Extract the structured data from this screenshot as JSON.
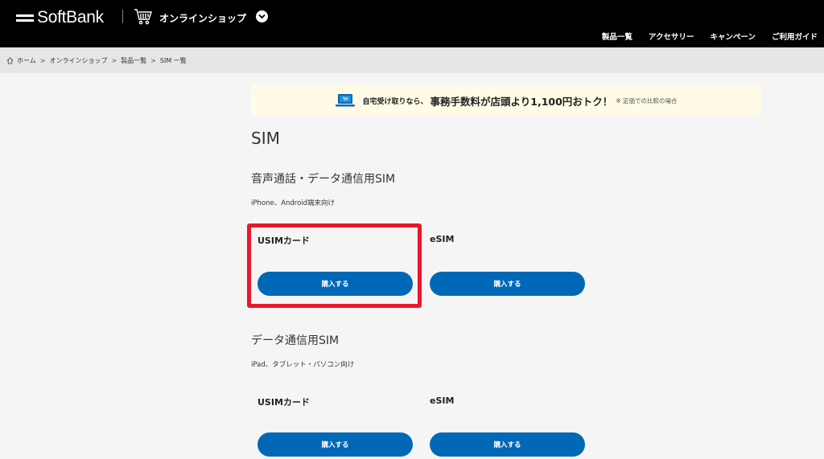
{
  "header": {
    "logo_text": "SoftBank",
    "shop_title": "オンラインショップ",
    "nav": [
      "製品一覧",
      "アクセサリー",
      "キャンペーン",
      "ご利用ガイド"
    ]
  },
  "breadcrumb": [
    "ホーム",
    "オンラインショップ",
    "製品一覧",
    "SIM 一覧"
  ],
  "banner": {
    "text1": "自宅受け取りなら、",
    "text2": "事務手数料が店頭より1,100円おトク！",
    "note": "※ 定価での比較の場合"
  },
  "page_title": "SIM",
  "sections": [
    {
      "title": "音声通話・データ通信用SIM",
      "description": "iPhone、Android端末向け",
      "cards": [
        {
          "title": "USIMカード",
          "button": "購入する"
        },
        {
          "title": "eSIM",
          "button": "購入する"
        }
      ]
    },
    {
      "title": "データ通信用SIM",
      "description": "iPad、タブレット・パソコン向け",
      "cards": [
        {
          "title": "USIMカード",
          "button": "購入する"
        },
        {
          "title": "eSIM",
          "button": "購入する"
        }
      ]
    }
  ],
  "colors": {
    "header_bg": "#000000",
    "button_bg": "#0068b7",
    "highlight": "#e8192c",
    "banner_bg": "#fffbe6"
  }
}
